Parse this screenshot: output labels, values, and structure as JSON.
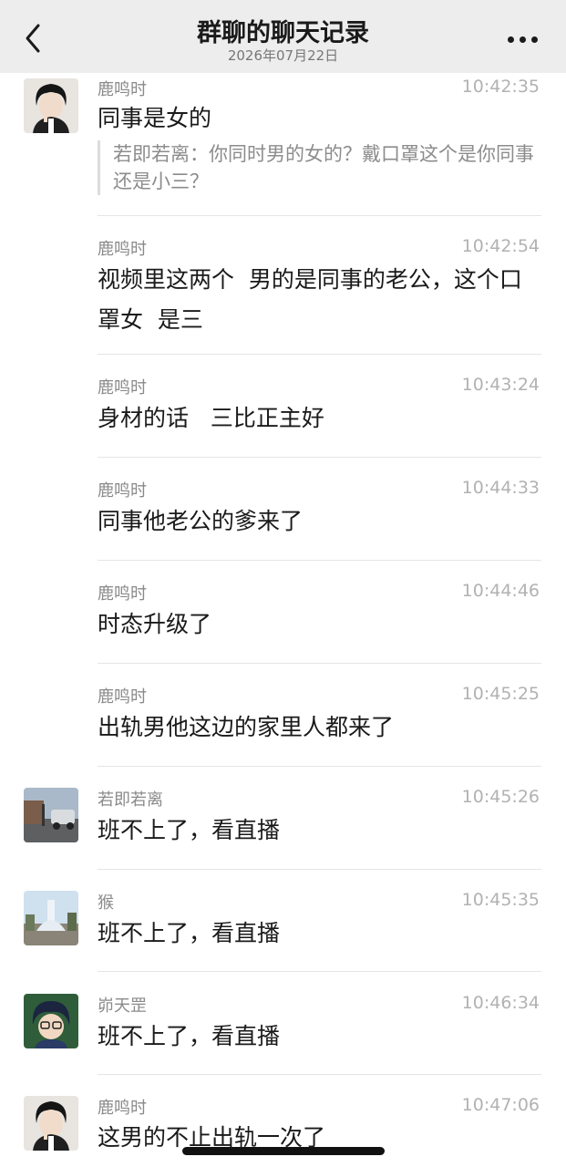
{
  "header": {
    "title": "群聊的聊天记录",
    "date": "2026年07月22日"
  },
  "messages": [
    {
      "sender": "鹿鸣时",
      "time": "10:42:35",
      "text": "同事是女的",
      "quote": "若即若离：你同时男的女的？戴口罩这个是你同事还是小三？",
      "avatar": "anime-man-avatar"
    },
    {
      "sender": "鹿鸣时",
      "time": "10:42:54",
      "text": "视频里这两个  男的是同事的老公，这个口罩女  是三"
    },
    {
      "sender": "鹿鸣时",
      "time": "10:43:24",
      "text": "身材的话   三比正主好"
    },
    {
      "sender": "鹿鸣时",
      "time": "10:44:33",
      "text": "同事他老公的爹来了"
    },
    {
      "sender": "鹿鸣时",
      "time": "10:44:46",
      "text": "时态升级了"
    },
    {
      "sender": "鹿鸣时",
      "time": "10:45:25",
      "text": "出轨男他这边的家里人都来了"
    },
    {
      "sender": "若即若离",
      "time": "10:45:26",
      "text": "班不上了，看直播",
      "avatar": "street-photo-avatar"
    },
    {
      "sender": "猴",
      "time": "10:45:35",
      "text": "班不上了，看直播",
      "avatar": "fountain-photo-avatar"
    },
    {
      "sender": "峁天罡",
      "time": "10:46:34",
      "text": "班不上了，看直播",
      "avatar": "anime-boy-avatar"
    },
    {
      "sender": "鹿鸣时",
      "time": "10:47:06",
      "text": "这男的不止出轨一次了",
      "avatar": "anime-man-avatar"
    }
  ]
}
